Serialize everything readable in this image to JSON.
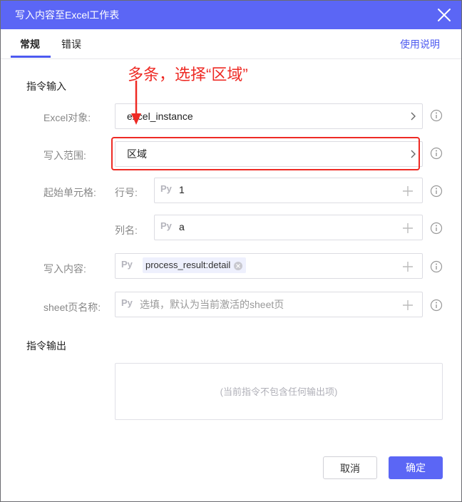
{
  "dialog": {
    "title": "写入内容至Excel工作表",
    "tabs": [
      {
        "label": "常规",
        "active": true
      },
      {
        "label": "错误",
        "active": false
      }
    ],
    "help_link": "使用说明"
  },
  "annotation": {
    "text": "多条，选择“区域”",
    "color": "#ee2a24"
  },
  "input_section": {
    "title": "指令输入",
    "excel_object": {
      "label": "Excel对象:",
      "value": "excel_instance"
    },
    "write_range": {
      "label": "写入范围:",
      "value": "区域"
    },
    "start_cell": {
      "label": "起始单元格:",
      "row": {
        "label": "行号:",
        "prefix": "Py",
        "value": "1"
      },
      "column": {
        "label": "列名:",
        "prefix": "Py",
        "value": "a"
      }
    },
    "write_content": {
      "label": "写入内容:",
      "prefix": "Py",
      "tag": "process_result:detail"
    },
    "sheet_name": {
      "label": "sheet页名称:",
      "prefix": "Py",
      "placeholder": "选填，默认为当前激活的sheet页"
    }
  },
  "output_section": {
    "title": "指令输出",
    "empty_text": "(当前指令不包含任何输出项)"
  },
  "buttons": {
    "cancel": "取消",
    "confirm": "确定"
  },
  "colors": {
    "accent": "#5b66f5",
    "link": "#4d5af0",
    "annotation": "#ee2a24"
  }
}
